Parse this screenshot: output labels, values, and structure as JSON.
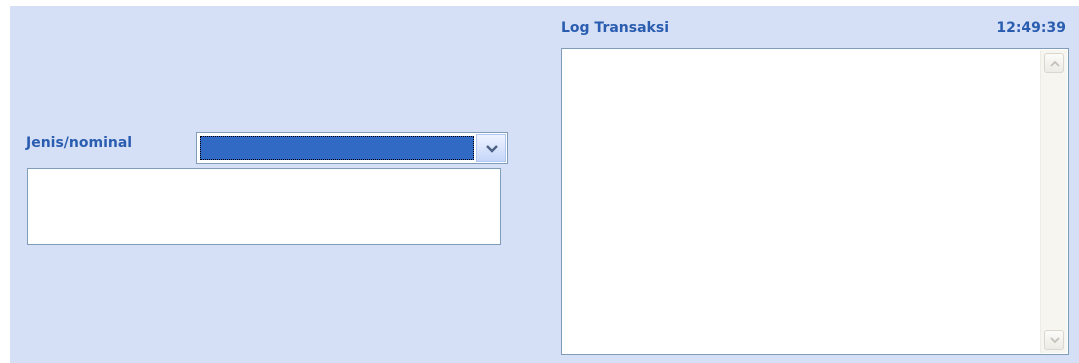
{
  "form": {
    "jenis_label": "Jenis/nominal",
    "jenis_selected": "",
    "detail_text": ""
  },
  "log": {
    "title": "Log Transaksi",
    "time": "12:49:39",
    "content": ""
  },
  "icons": {
    "dropdown": "chevron-down-icon",
    "scroll_up": "scroll-up-arrow-icon",
    "scroll_down": "scroll-down-arrow-icon"
  },
  "colors": {
    "panel_bg": "#d5dff5",
    "label_text": "#2a5db0",
    "selection_highlight": "#316ac5",
    "field_border": "#7f9db9"
  }
}
